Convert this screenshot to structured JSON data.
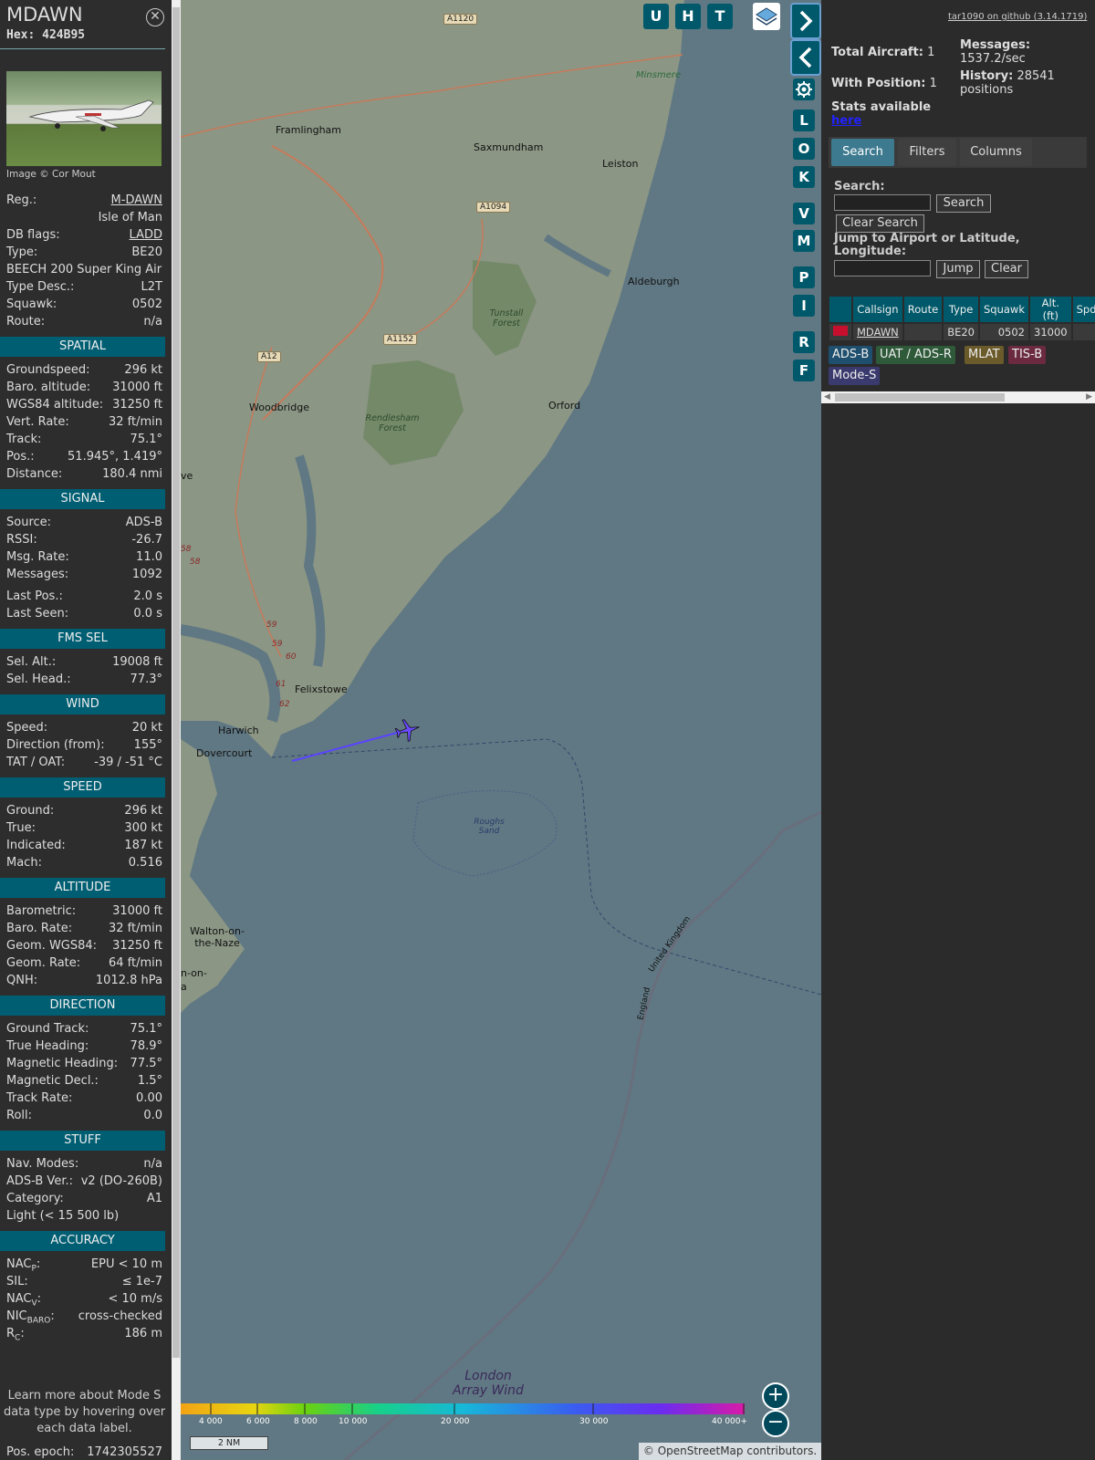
{
  "aircraft": {
    "callsign": "MDAWN",
    "hex": "Hex: 424B95",
    "photo_credit": "Image © Cor Mout"
  },
  "top_rows": [
    {
      "k": "Reg.:",
      "v": "M-DAWN",
      "link": true
    },
    {
      "k": "",
      "v": "Isle of Man"
    },
    {
      "k": "DB flags:",
      "v": "LADD",
      "link": true
    },
    {
      "k": "Type:",
      "v": "BE20"
    },
    {
      "k": "BEECH 200 Super King Air",
      "v": ""
    },
    {
      "k": "Type Desc.:",
      "v": "L2T"
    },
    {
      "k": "Squawk:",
      "v": "0502"
    },
    {
      "k": "Route:",
      "v": "n/a"
    }
  ],
  "sections": [
    {
      "title": "SPATIAL",
      "rows": [
        {
          "k": "Groundspeed:",
          "v": "296 kt"
        },
        {
          "k": "Baro. altitude:",
          "v": "31000 ft"
        },
        {
          "k": "WGS84 altitude:",
          "v": "31250 ft"
        },
        {
          "k": "Vert. Rate:",
          "v": "32 ft/min"
        },
        {
          "k": "Track:",
          "v": "75.1°"
        },
        {
          "k": "Pos.:",
          "v": "51.945°, 1.419°"
        },
        {
          "k": "Distance:",
          "v": "180.4 nmi"
        }
      ]
    },
    {
      "title": "SIGNAL",
      "rows": [
        {
          "k": "Source:",
          "v": "ADS-B"
        },
        {
          "k": "RSSI:",
          "v": "-26.7"
        },
        {
          "k": "Msg. Rate:",
          "v": "11.0"
        },
        {
          "k": "Messages:",
          "v": "1092"
        },
        {
          "k": "Last Pos.:",
          "v": "2.0 s"
        },
        {
          "k": "Last Seen:",
          "v": "0.0 s"
        }
      ]
    },
    {
      "title": "FMS SEL",
      "rows": [
        {
          "k": "Sel. Alt.:",
          "v": "19008 ft"
        },
        {
          "k": "Sel. Head.:",
          "v": "77.3°"
        }
      ]
    },
    {
      "title": "WIND",
      "rows": [
        {
          "k": "Speed:",
          "v": "20 kt"
        },
        {
          "k": "Direction (from):",
          "v": "155°"
        },
        {
          "k": "TAT / OAT:",
          "v": "-39 / -51 °C"
        }
      ]
    },
    {
      "title": "SPEED",
      "rows": [
        {
          "k": "Ground:",
          "v": "296 kt"
        },
        {
          "k": "True:",
          "v": "300 kt"
        },
        {
          "k": "Indicated:",
          "v": "187 kt"
        },
        {
          "k": "Mach:",
          "v": "0.516"
        }
      ]
    },
    {
      "title": "ALTITUDE",
      "rows": [
        {
          "k": "Barometric:",
          "v": "31000 ft"
        },
        {
          "k": "Baro. Rate:",
          "v": "32 ft/min"
        },
        {
          "k": "Geom. WGS84:",
          "v": "31250 ft"
        },
        {
          "k": "Geom. Rate:",
          "v": "64 ft/min"
        },
        {
          "k": "QNH:",
          "v": "1012.8 hPa"
        }
      ]
    },
    {
      "title": "DIRECTION",
      "rows": [
        {
          "k": "Ground Track:",
          "v": "75.1°"
        },
        {
          "k": "True Heading:",
          "v": "78.9°"
        },
        {
          "k": "Magnetic Heading:",
          "v": "77.5°"
        },
        {
          "k": "Magnetic Decl.:",
          "v": "1.5°"
        },
        {
          "k": "Track Rate:",
          "v": "0.00"
        },
        {
          "k": "Roll:",
          "v": "0.0"
        }
      ]
    },
    {
      "title": "STUFF",
      "rows": [
        {
          "k": "Nav. Modes:",
          "v": "n/a"
        },
        {
          "k": "ADS-B Ver.:",
          "v": "v2 (DO-260B)"
        },
        {
          "k": "Category:",
          "v": "A1"
        },
        {
          "k": "Light (< 15 500 lb)",
          "v": ""
        }
      ]
    },
    {
      "title": "ACCURACY",
      "rows": [
        {
          "k": "NAC",
          "sub": "P",
          "k2": ":",
          "v": "EPU < 10 m"
        },
        {
          "k": "SIL:",
          "v": "≤ 1e-7"
        },
        {
          "k": "NAC",
          "sub": "V",
          "k2": ":",
          "v": "< 10 m/s"
        },
        {
          "k": "NIC",
          "sub": "BARO",
          "k2": ":",
          "v": "cross-checked"
        },
        {
          "k": "R",
          "sub": "C",
          "k2": ":",
          "v": "186 m"
        }
      ]
    }
  ],
  "learn_more": "Learn more about Mode S data type by hovering over each data label.",
  "pos_epoch": {
    "k": "Pos. epoch:",
    "v": "1742305527"
  },
  "map": {
    "buttons_top": [
      "U",
      "H",
      "T"
    ],
    "side_buttons": [
      "L",
      "O",
      "K",
      "V",
      "M",
      "P",
      "I",
      "R",
      "F"
    ],
    "places": [
      "Framlingham",
      "Saxmundham",
      "Leiston",
      "Minsmere",
      "Aldeburgh",
      "Tunstall Forest",
      "Woodbridge",
      "Rendlesham Forest",
      "Orford",
      "Felixstowe",
      "Harwich",
      "Dovercourt",
      "Roughs Sand",
      "Walton-on-the-Naze",
      "London Array Wind",
      "England",
      "United Kingdom",
      "ve",
      "n-on-",
      "a"
    ],
    "roads": [
      "A1120",
      "A1094",
      "A1152",
      "A12"
    ],
    "junctions": [
      "58",
      "58",
      "59",
      "59",
      "60",
      "61",
      "62"
    ],
    "alt_ticks": [
      "4 000",
      "6 000",
      "8 000",
      "10 000",
      "20 000",
      "30 000",
      "40 000+"
    ],
    "scale": "2 NM",
    "attribution_prefix": "© ",
    "attribution_link": "OpenStreetMap",
    "attribution_suffix": " contributors."
  },
  "right": {
    "github": "tar1090 on github (3.14.1719)",
    "total_aircraft_label": "Total Aircraft:",
    "total_aircraft": "1",
    "with_position_label": "With Position:",
    "with_position": "1",
    "messages_label": "Messages:",
    "messages_rate": "1537.2/sec",
    "history_label": "History:",
    "history_value": "28541",
    "history_unit": "positions",
    "stats_label": "Stats available",
    "stats_link": "here",
    "tabs": [
      "Search",
      "Filters",
      "Columns"
    ],
    "search_label": "Search:",
    "search_button": "Search",
    "clear_search_button": "Clear Search",
    "jump_label": "Jump to Airport or Latitude, Longitude:",
    "jump_button": "Jump",
    "clear_button": "Clear",
    "table_headers": [
      "",
      "Callsign",
      "Route",
      "Type",
      "Squawk",
      "Alt. (ft)",
      "Spd."
    ],
    "table_rows": [
      {
        "callsign": "MDAWN",
        "route": "",
        "type": "BE20",
        "squawk": "0502",
        "alt": "31000",
        "spd": ""
      }
    ],
    "sources": [
      {
        "label": "ADS-B",
        "color": "#1f4f6e"
      },
      {
        "label": "UAT / ADS-R",
        "color": "#2f5a3a"
      },
      {
        "label": "MLAT",
        "color": "#6b5a2a"
      },
      {
        "label": "TIS-B",
        "color": "#6b2a3f"
      },
      {
        "label": "Mode-S",
        "color": "#3a3a6e"
      }
    ]
  }
}
